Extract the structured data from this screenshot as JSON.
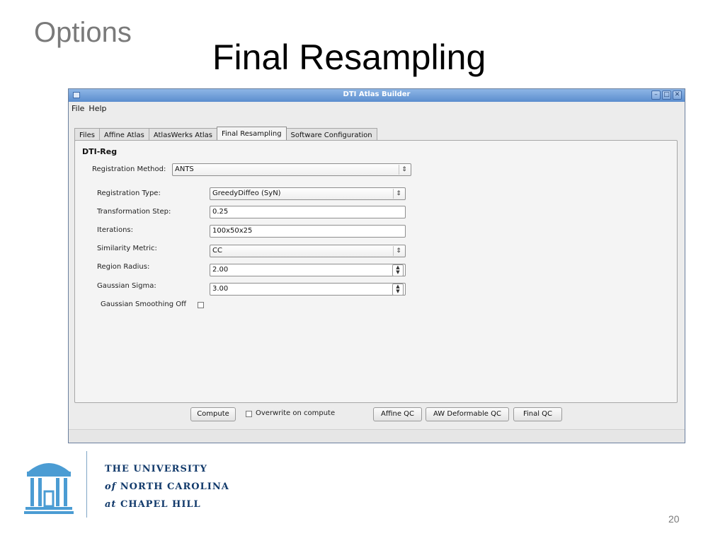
{
  "slide": {
    "section": "Options",
    "title": "Final Resampling",
    "page_number": "20"
  },
  "window": {
    "title": "DTI Atlas Builder",
    "menu": [
      "File",
      "Help"
    ]
  },
  "tabs": [
    "Files",
    "Affine Atlas",
    "AtlasWerks Atlas",
    "Final Resampling",
    "Software Configuration"
  ],
  "active_tab": "Final Resampling",
  "panel": {
    "group_title": "DTI-Reg",
    "registration_method_label": "Registration Method:",
    "registration_method_value": "ANTS",
    "fields": {
      "registration_type": {
        "label": "Registration Type:",
        "value": "GreedyDiffeo (SyN)"
      },
      "transformation_step": {
        "label": "Transformation Step:",
        "value": "0.25"
      },
      "iterations": {
        "label": "Iterations:",
        "value": "100x50x25"
      },
      "similarity_metric": {
        "label": "Similarity Metric:",
        "value": "CC"
      },
      "region_radius": {
        "label": "Region Radius:",
        "value": "2.00"
      },
      "gaussian_sigma": {
        "label": "Gaussian Sigma:",
        "value": "3.00"
      }
    },
    "gaussian_smoothing_off_label": "Gaussian Smoothing Off",
    "gaussian_smoothing_off_checked": false
  },
  "bottom": {
    "compute": "Compute",
    "overwrite_label": "Overwrite on compute",
    "overwrite_checked": false,
    "affine_qc": "Affine QC",
    "aw_deformable_qc": "AW Deformable QC",
    "final_qc": "Final QC"
  },
  "university": {
    "line1": "THE UNIVERSITY",
    "line2_prefix": "of",
    "line2": "NORTH CAROLINA",
    "line3_prefix": "at",
    "line3": "CHAPEL HILL"
  },
  "colors": {
    "titlebar": "#5b8dce",
    "unc_blue": "#4b9cd3",
    "unc_navy": "#123a6b"
  }
}
